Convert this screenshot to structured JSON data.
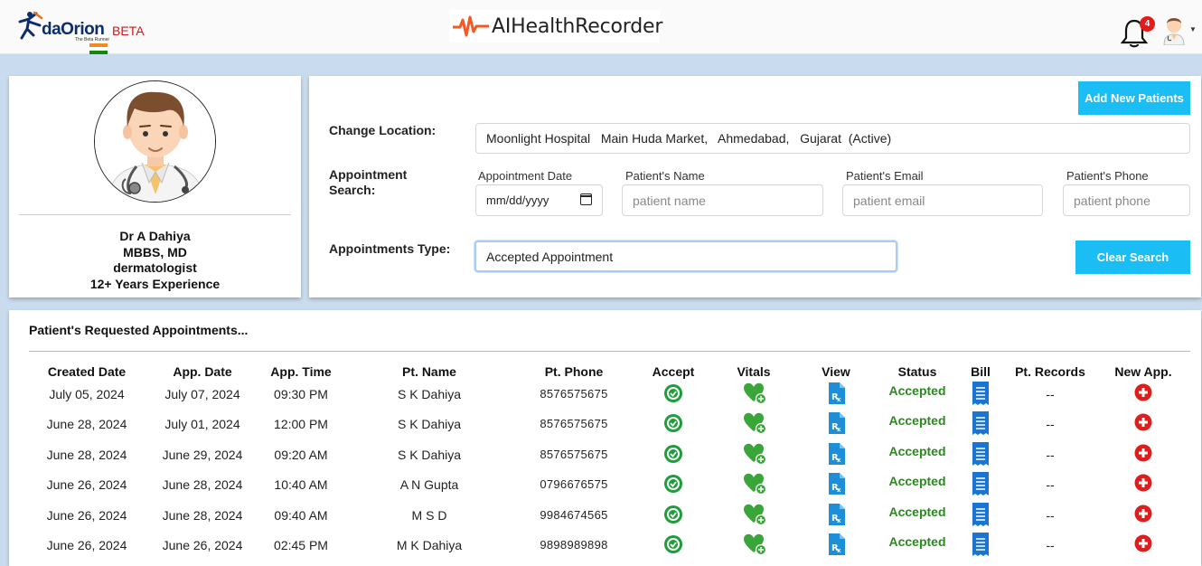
{
  "header": {
    "logo_text": "daOrion",
    "logo_tagline": "The Beta Runner",
    "logo_beta": "BETA",
    "brand": "AIHealthRecorder",
    "notification_count": "4",
    "accent": "#1bbdf5"
  },
  "profile": {
    "name": "Dr A Dahiya",
    "degree": "MBBS, MD",
    "specialty": "dermatologist",
    "experience": "12+ Years Experience"
  },
  "search": {
    "add_button": "Add New Patients",
    "clear_button": "Clear Search",
    "location_label": "Change Location:",
    "location_value": "Moonlight Hospital   Main Huda Market,   Ahmedabad,   Gujarat  (Active)",
    "appointment_search_label_1": "Appointment",
    "appointment_search_label_2": "Search:",
    "date_label": "Appointment Date",
    "date_placeholder": "mm/dd/yyyy",
    "name_label": "Patient's Name",
    "name_placeholder": "patient name",
    "email_label": "Patient's Email",
    "email_placeholder": "patient email",
    "phone_label": "Patient's Phone",
    "phone_placeholder": "patient phone",
    "type_label": "Appointments Type:",
    "type_value": "Accepted Appointment"
  },
  "table": {
    "title": "Patient's Requested Appointments...",
    "headers": [
      "Created Date",
      "App. Date",
      "App. Time",
      "Pt. Name",
      "Pt. Phone",
      "Accept",
      "Vitals",
      "View",
      "Status",
      "Bill",
      "Pt. Records",
      "New App."
    ],
    "rows": [
      {
        "created": "July 05, 2024",
        "app_date": "July 07, 2024",
        "time": "09:30 PM",
        "name": "S K Dahiya",
        "phone": "8576575675",
        "status": "Accepted",
        "records": "--"
      },
      {
        "created": "June 28, 2024",
        "app_date": "July 01, 2024",
        "time": "12:00 PM",
        "name": "S K Dahiya",
        "phone": "8576575675",
        "status": "Accepted",
        "records": "--"
      },
      {
        "created": "June 28, 2024",
        "app_date": "June 29, 2024",
        "time": "09:20 AM",
        "name": "S K Dahiya",
        "phone": "8576575675",
        "status": "Accepted",
        "records": "--"
      },
      {
        "created": "June 26, 2024",
        "app_date": "June 28, 2024",
        "time": "10:40 AM",
        "name": "A N Gupta",
        "phone": "0796676575",
        "status": "Accepted",
        "records": "--"
      },
      {
        "created": "June 26, 2024",
        "app_date": "June 28, 2024",
        "time": "09:40 AM",
        "name": "M S D",
        "phone": "9984674565",
        "status": "Accepted",
        "records": "--"
      },
      {
        "created": "June 26, 2024",
        "app_date": "June 26, 2024",
        "time": "02:45 PM",
        "name": "M K Dahiya",
        "phone": "9898989898",
        "status": "Accepted",
        "records": "--"
      }
    ]
  }
}
